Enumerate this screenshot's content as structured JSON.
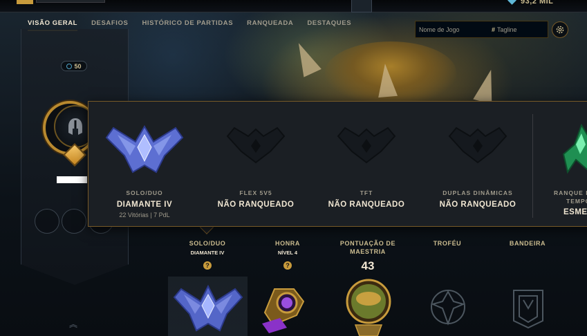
{
  "currency": {
    "amount": "93,2 MIL",
    "icon": "blue-essence-icon"
  },
  "nav": {
    "items": [
      "VISÃO GERAL",
      "DESAFIOS",
      "HISTÓRICO DE PARTIDAS",
      "RANQUEADA",
      "DESTAQUES"
    ],
    "active_index": 0
  },
  "search": {
    "game_name_placeholder": "Nome de Jogo",
    "tagline_label": "Tagline",
    "hash": "#"
  },
  "profile": {
    "level": "50"
  },
  "ranked_popup": {
    "queues": [
      {
        "label": "SOLO/DUO",
        "tier": "DIAMANTE IV",
        "stats": "22 Vitórias | 7 PdL",
        "emblem": "diamond-emblem-icon"
      },
      {
        "label": "FLEX 5V5",
        "tier": "NÃO RANQUEADO",
        "stats": "",
        "emblem": "unranked-emblem-icon"
      },
      {
        "label": "TFT",
        "tier": "NÃO RANQUEADO",
        "stats": "",
        "emblem": "unranked-emblem-icon"
      },
      {
        "label": "DUPLAS DINÂMICAS",
        "tier": "NÃO RANQUEADO",
        "stats": "",
        "emblem": "unranked-emblem-icon"
      },
      {
        "label": "RANQUE D",
        "label2": "TEMPO",
        "tier": "ESMER",
        "stats": "",
        "emblem": "emerald-emblem-icon"
      }
    ]
  },
  "stats_row": {
    "solo": {
      "title": "SOLO/DUO",
      "sub": "DIAMANTE IV",
      "help": "?"
    },
    "honor": {
      "title": "HONRA",
      "sub": "NÍVEL 4",
      "help": "?"
    },
    "mastery": {
      "title_line1": "PONTUAÇÃO DE",
      "title_line2": "MAESTRIA",
      "value": "43"
    },
    "trophy": {
      "title": "TROFÉU"
    },
    "banner": {
      "title": "BANDEIRA"
    }
  },
  "colors": {
    "gold": "#c89b3c",
    "diamond": "#6c7fd8",
    "emerald": "#2fbf71",
    "text_light": "#f0e6d2"
  }
}
